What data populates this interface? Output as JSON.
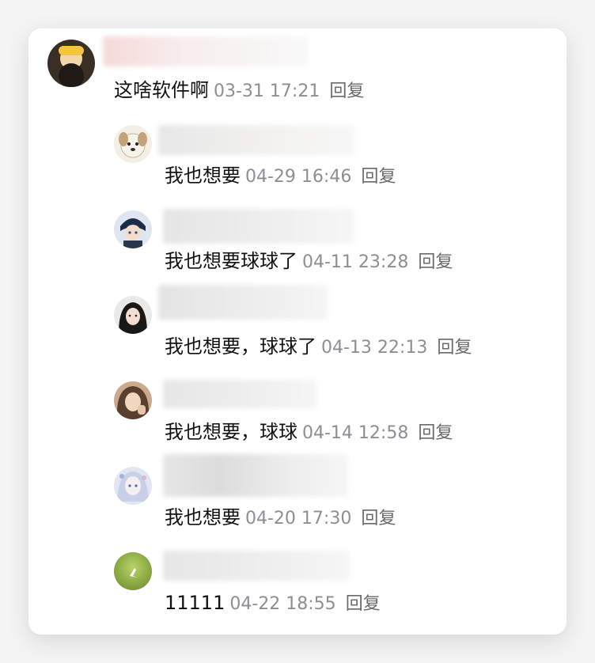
{
  "root_comment": {
    "text": "这啥软件啊",
    "time": "03-31 17:21",
    "reply_label": "回复"
  },
  "replies": [
    {
      "text": "我也想要",
      "time": "04-29 16:46",
      "reply_label": "回复"
    },
    {
      "text": "我也想要球球了",
      "time": "04-11 23:28",
      "reply_label": "回复"
    },
    {
      "text": "我也想要，球球了",
      "time": "04-13 22:13",
      "reply_label": "回复"
    },
    {
      "text": "我也想要，球球",
      "time": "04-14 12:58",
      "reply_label": "回复"
    },
    {
      "text": "我也想要",
      "time": "04-20 17:30",
      "reply_label": "回复"
    },
    {
      "text": "11111",
      "time": "04-22 18:55",
      "reply_label": "回复"
    }
  ]
}
